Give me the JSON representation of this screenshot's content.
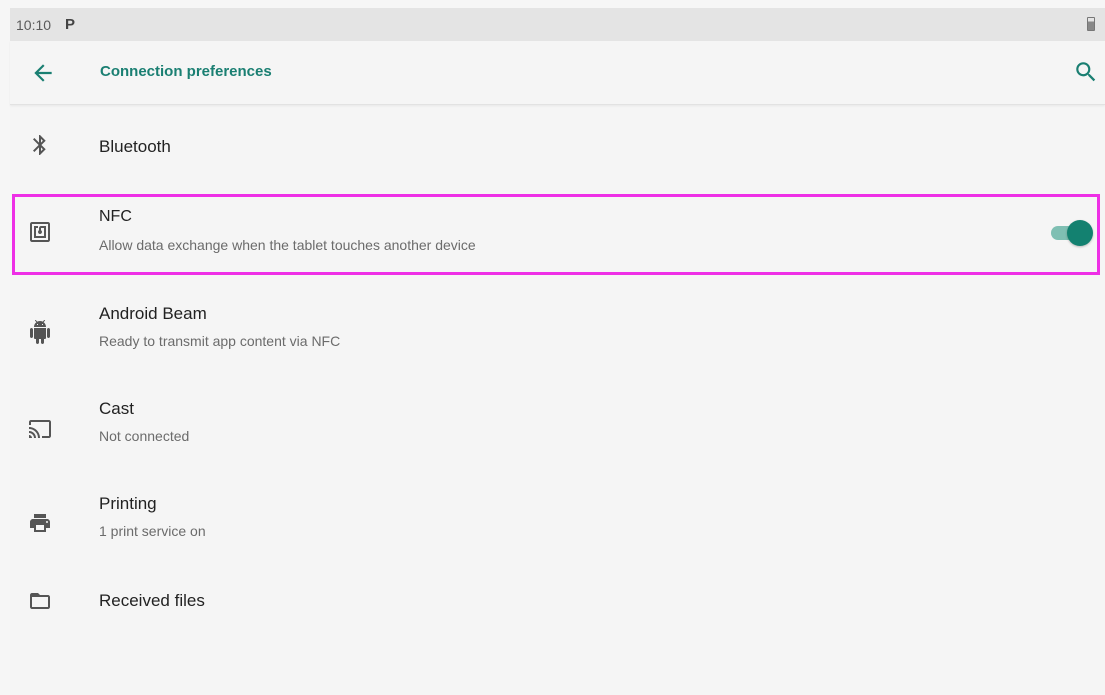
{
  "status_bar": {
    "time": "10:10",
    "notification_glyph": "P"
  },
  "app_bar": {
    "title": "Connection preferences",
    "back_icon": "arrow-back-icon",
    "search_icon": "search-icon"
  },
  "items": [
    {
      "icon": "bluetooth-icon",
      "title": "Bluetooth",
      "subtitle": ""
    },
    {
      "icon": "nfc-icon",
      "title": "NFC",
      "subtitle": "Allow data exchange when the tablet touches another device",
      "toggle_on": true
    },
    {
      "icon": "android-icon",
      "title": "Android Beam",
      "subtitle": "Ready to transmit app content via NFC"
    },
    {
      "icon": "cast-icon",
      "title": "Cast",
      "subtitle": "Not connected"
    },
    {
      "icon": "printer-icon",
      "title": "Printing",
      "subtitle": "1 print service on"
    },
    {
      "icon": "folder-icon",
      "title": "Received files",
      "subtitle": ""
    }
  ],
  "colors": {
    "accent": "#1a7f72",
    "toggle_thumb": "#138170",
    "toggle_track": "#7fbfb3",
    "highlight_border": "#ee2fe6"
  }
}
